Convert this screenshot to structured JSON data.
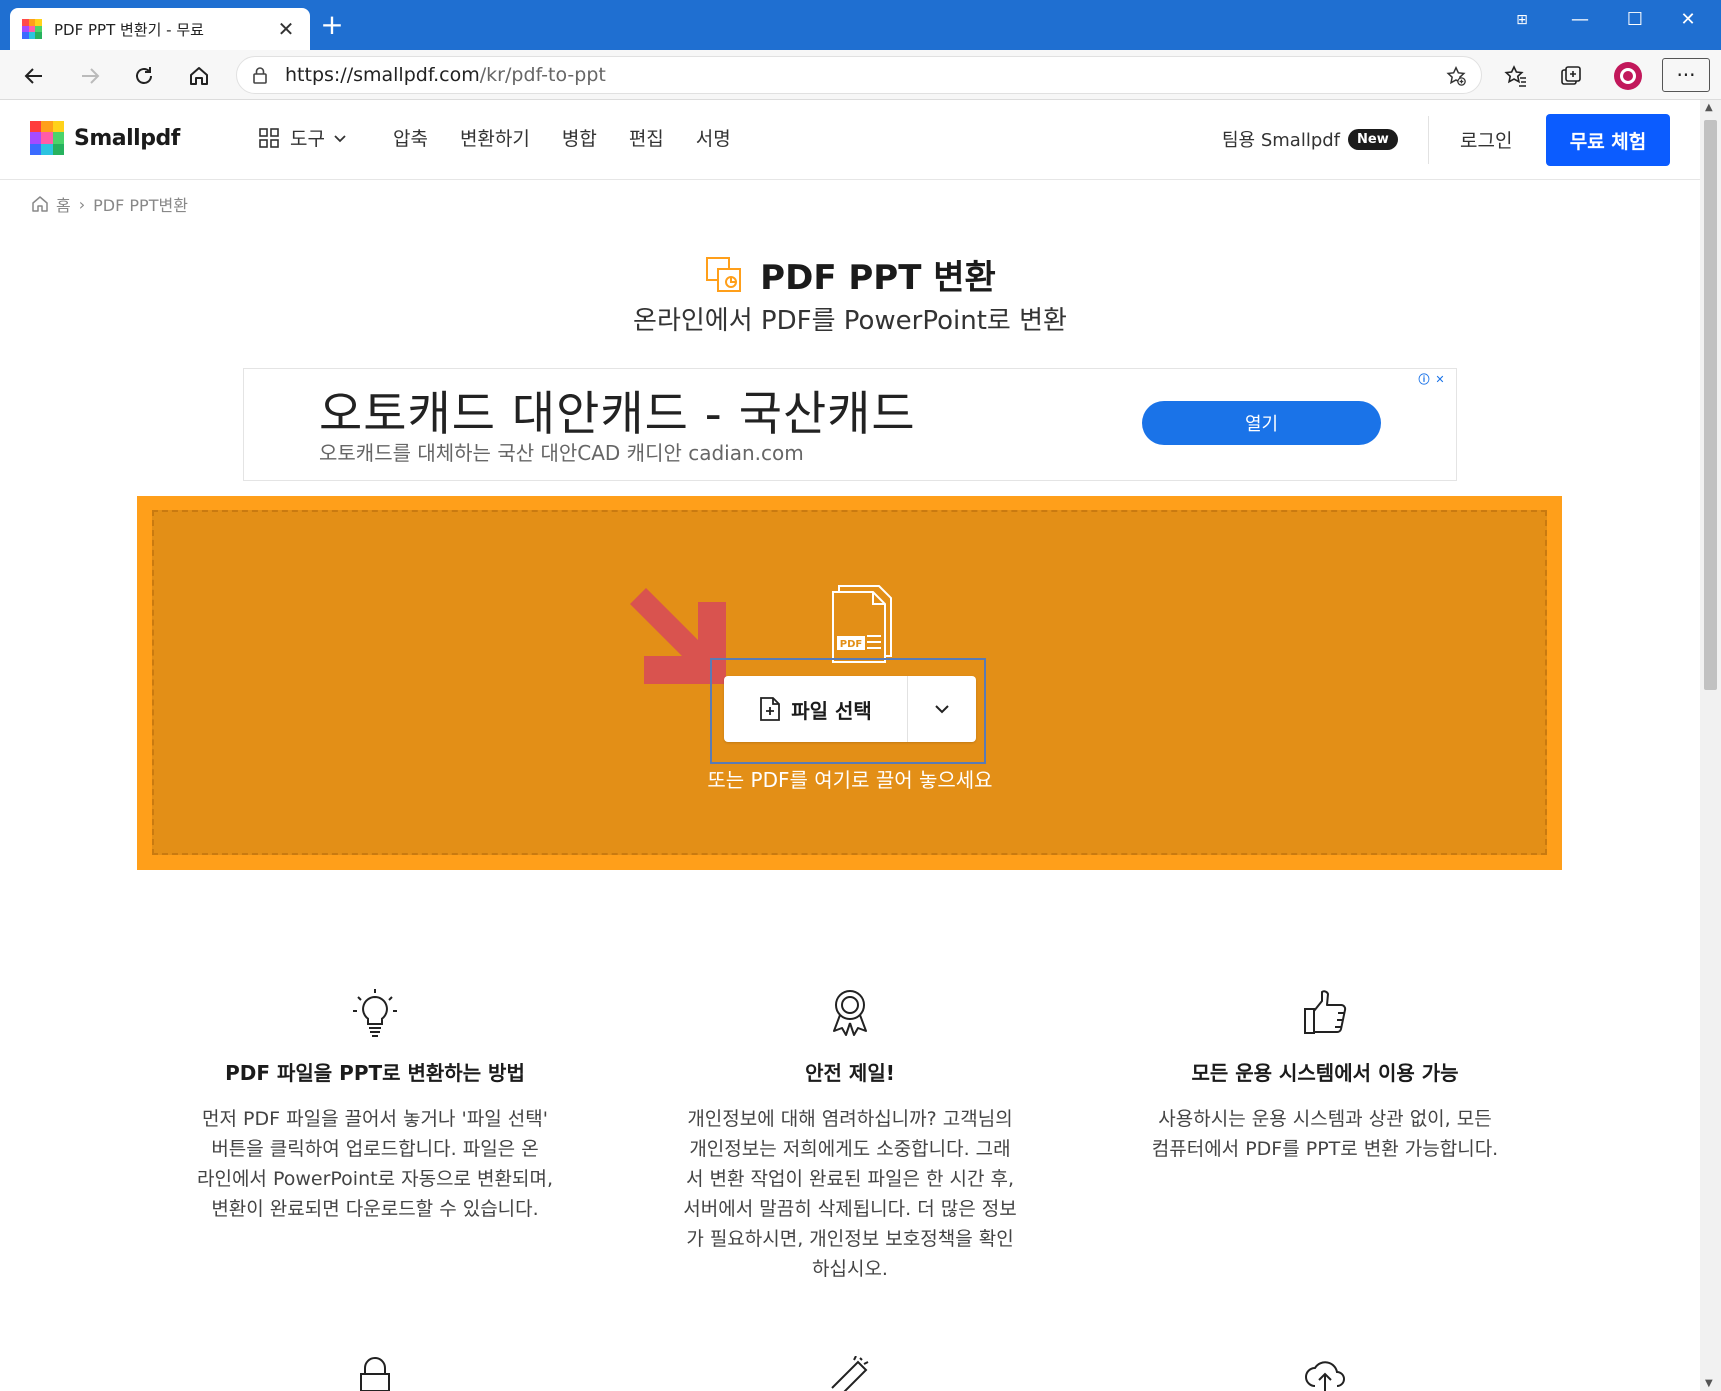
{
  "browser": {
    "tab_title": "PDF PPT 변환기 - 무료",
    "new_tab_symbol": "+",
    "url_host": "https://smallpdf.com",
    "url_path": "/kr/pdf-to-ppt",
    "menu_symbol": "···"
  },
  "header": {
    "logo_text": "Smallpdf",
    "nav": {
      "tools": "도구",
      "compress": "압축",
      "convert": "변환하기",
      "merge": "병합",
      "edit": "편집",
      "sign": "서명"
    },
    "team_label": "팀용 Smallpdf",
    "team_badge": "New",
    "login": "로그인",
    "trial": "무료 체험"
  },
  "breadcrumb": {
    "home": "홈",
    "separator": "›",
    "current": "PDF PPT변환"
  },
  "hero": {
    "title": "PDF PPT 변환",
    "subtitle": "온라인에서 PDF를 PowerPoint로 변환"
  },
  "ad": {
    "title": "오토캐드 대안캐드 - 국산캐드",
    "description": "오토캐드를 대체하는 국산 대안CAD 캐디안 cadian.com",
    "open_button": "열기"
  },
  "dropzone": {
    "choose_file": "파일 선택",
    "hint": "또는 PDF를 여기로 끌어 놓으세요",
    "doc_badge": "PDF"
  },
  "features": [
    {
      "icon": "lightbulb-icon",
      "title": "PDF 파일을 PPT로 변환하는 방법",
      "lines": [
        "먼저 PDF 파일을 끌어서 놓거나 '파일 선택'",
        "버튼을 클릭하여 업로드합니다. 파일은 온",
        "라인에서 PowerPoint로 자동으로 변환되며,",
        "변환이 완료되면 다운로드할 수 있습니다."
      ]
    },
    {
      "icon": "award-icon",
      "title": "안전 제일!",
      "lines": [
        "개인정보에 대해 염려하십니까? 고객님의",
        "개인정보는 저희에게도 소중합니다. 그래",
        "서 변환 작업이 완료된 파일은 한 시간 후,",
        "서버에서 말끔히 삭제됩니다. 더 많은 정보",
        "가 필요하시면, 개인정보 보호정책을 확인",
        "하십시오."
      ]
    },
    {
      "icon": "thumbs-up-icon",
      "title": "모든 운용 시스템에서 이용 가능",
      "lines": [
        "사용하시는 운용 시스템과 상관 없이, 모든",
        "컴퓨터에서 PDF를 PPT로 변환 가능합니다."
      ]
    }
  ],
  "colors": {
    "titlebar": "#1f6fd1",
    "trial_button": "#0b5cff",
    "dropzone_outer": "#ff9f1a",
    "dropzone_inner": "#e38f17",
    "ad_button": "#1a73e8",
    "arrow": "#d9534f"
  }
}
